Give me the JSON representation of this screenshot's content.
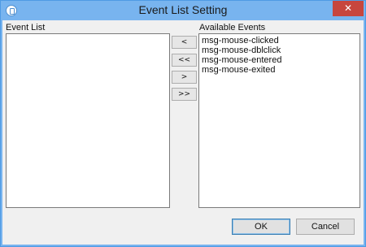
{
  "window": {
    "title": "Event List Setting",
    "close_label": "✕"
  },
  "left_panel": {
    "label": "Event List",
    "items": []
  },
  "right_panel": {
    "label": "Available Events",
    "items": [
      "msg-mouse-clicked",
      "msg-mouse-dblclick",
      "msg-mouse-entered",
      "msg-mouse-exited"
    ]
  },
  "move_buttons": {
    "move_left": "<",
    "move_all_left": "<<",
    "move_right": ">",
    "move_all_right": ">>"
  },
  "footer": {
    "ok_label": "OK",
    "cancel_label": "Cancel"
  },
  "icons": {
    "app": "app-icon",
    "close": "close-icon"
  }
}
